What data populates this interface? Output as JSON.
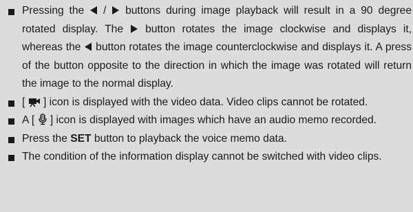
{
  "notes": {
    "n1": {
      "p1": "Pressing the ",
      "sep": " / ",
      "p2": " buttons during image playback will result in a 90 degree rotated display. The ",
      "p3": " button rotates the image clockwise and displays it, whereas the ",
      "p4": " button rotates the image counterclockwise and displays it. A press of the button opposite to the direction in which the image was rotated will return the image to the normal display.",
      "icon_left": "left-triangle-icon",
      "icon_right": "right-triangle-icon"
    },
    "n2": {
      "open": "[ ",
      "close": " ] icon is displayed with the video data. Video clips cannot be rotated.",
      "icon": "video-camera-icon"
    },
    "n3": {
      "open": " A [ ",
      "close": " ] icon is displayed with images which have an audio memo recorded.",
      "icon": "microphone-icon"
    },
    "n4": {
      "pre": "Press the ",
      "bold": "SET",
      "post": " button to playback the voice memo data."
    },
    "n5": {
      "text": " The condition of the information display cannot be switched with video clips."
    }
  },
  "colors": {
    "background": "#dcdcdc",
    "text": "#1a1a1a"
  }
}
